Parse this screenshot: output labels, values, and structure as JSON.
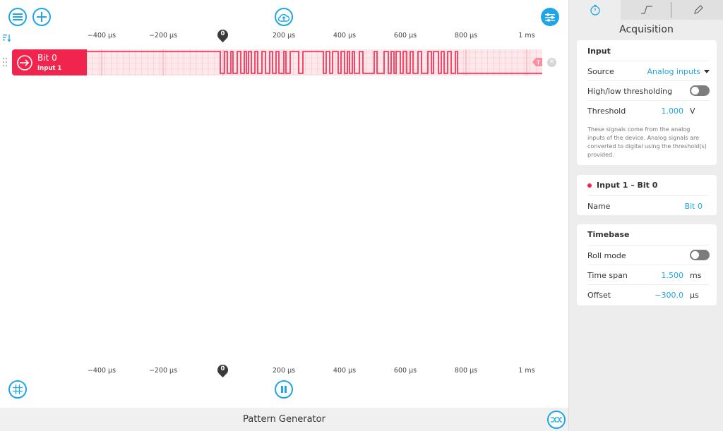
{
  "main": {
    "axis_ticks": [
      "−400 µs",
      "−200 µs",
      "0",
      "200 µs",
      "400 µs",
      "600 µs",
      "800 µs",
      "1 ms"
    ],
    "channel": {
      "name": "Bit 0",
      "sub": "Input 1",
      "color": "#f0244c"
    },
    "trigger_badge": "T"
  },
  "footer": {
    "title": "Pattern Generator"
  },
  "sidebar": {
    "title": "Acquisition",
    "input": {
      "header": "Input",
      "source_label": "Source",
      "source_value": "Analog inputs",
      "thresholding_label": "High/low thresholding",
      "threshold_label": "Threshold",
      "threshold_value": "1.000",
      "threshold_unit": "V",
      "note": "These signals come from the analog inputs of the device. Analog signals are converted to digital using the threshold(s) provided."
    },
    "channel_card": {
      "header": "Input 1 – Bit 0",
      "name_label": "Name",
      "name_value": "Bit 0"
    },
    "timebase": {
      "header": "Timebase",
      "roll_label": "Roll mode",
      "span_label": "Time span",
      "span_value": "1.500",
      "span_unit": "ms",
      "offset_label": "Offset",
      "offset_value": "−300.0",
      "offset_unit": "µs"
    }
  },
  "colors": {
    "accent": "#1ea6e6",
    "signal": "#f0244c"
  }
}
